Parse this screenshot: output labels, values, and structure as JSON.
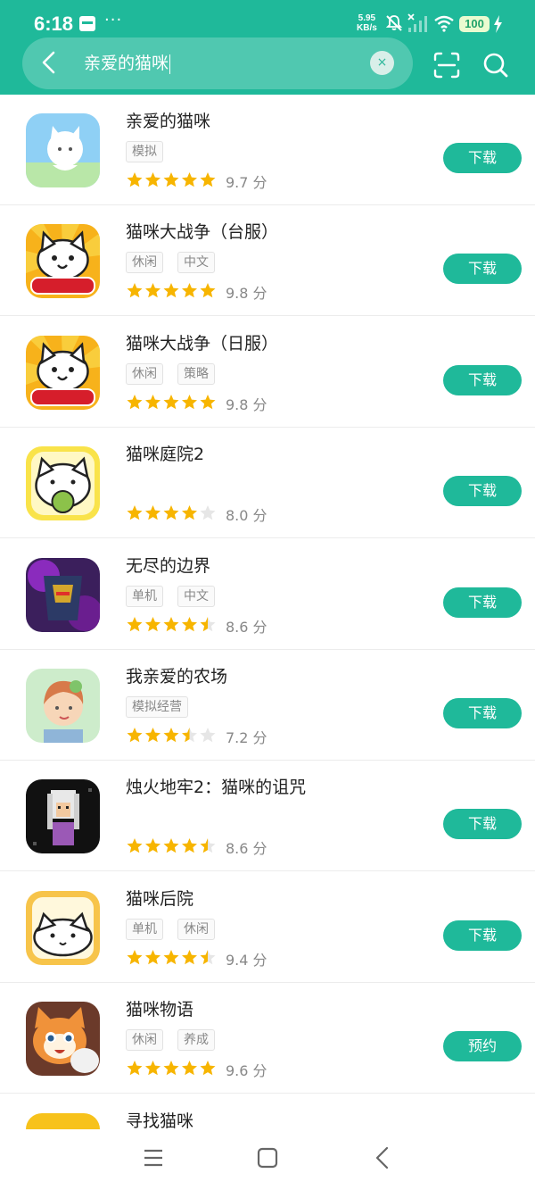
{
  "status_bar": {
    "time": "6:18",
    "net_speed_value": "5.95",
    "net_speed_unit": "KB/s",
    "battery": "100"
  },
  "search": {
    "query": "亲爱的猫咪",
    "clear_symbol": "×"
  },
  "icons": {
    "back": "chevron-left-icon",
    "clear": "close-icon",
    "scan": "scan-icon",
    "search": "search-icon"
  },
  "colors": {
    "brand": "#1fb99a",
    "star": "#f7b500",
    "star_empty": "#e6e6e6"
  },
  "apps": [
    {
      "name": "亲爱的猫咪",
      "tags": [
        "模拟"
      ],
      "rating": 5,
      "score": "9.7 分",
      "action": "下载",
      "icon": "cat-game-icon"
    },
    {
      "name": "猫咪大战争（台服）",
      "tags": [
        "休闲",
        "中文"
      ],
      "rating": 5,
      "score": "9.8 分",
      "action": "下载",
      "icon": "battle-cats-icon"
    },
    {
      "name": "猫咪大战争（日服）",
      "tags": [
        "休闲",
        "策略"
      ],
      "rating": 5,
      "score": "9.8 分",
      "action": "下载",
      "icon": "battle-cats-icon"
    },
    {
      "name": "猫咪庭院2",
      "tags": [],
      "rating": 4,
      "score": "8.0 分",
      "action": "下载",
      "icon": "cat-courtyard-icon"
    },
    {
      "name": "无尽的边界",
      "tags": [
        "单机",
        "中文"
      ],
      "rating": 4.5,
      "score": "8.6 分",
      "action": "下载",
      "icon": "warrior-game-icon"
    },
    {
      "name": "我亲爱的农场",
      "tags": [
        "模拟经营"
      ],
      "rating": 3.5,
      "score": "7.2 分",
      "action": "下载",
      "icon": "farm-girl-icon"
    },
    {
      "name": "烛火地牢2：猫咪的诅咒",
      "tags": [],
      "rating": 4.5,
      "score": "8.6 分",
      "action": "下载",
      "icon": "pixel-dungeon-icon"
    },
    {
      "name": "猫咪后院",
      "tags": [
        "单机",
        "休闲"
      ],
      "rating": 4.5,
      "score": "9.4 分",
      "action": "下载",
      "icon": "neko-backyard-icon"
    },
    {
      "name": "猫咪物语",
      "tags": [
        "休闲",
        "养成"
      ],
      "rating": 5,
      "score": "9.6 分",
      "action": "预约",
      "icon": "cat-story-icon"
    },
    {
      "name": "寻找猫咪",
      "tags": [],
      "rating": null,
      "score": "",
      "action": "",
      "icon": "find-cat-icon"
    }
  ],
  "nav": {
    "menu": "menu-icon",
    "home": "home-icon",
    "back": "back-icon"
  }
}
